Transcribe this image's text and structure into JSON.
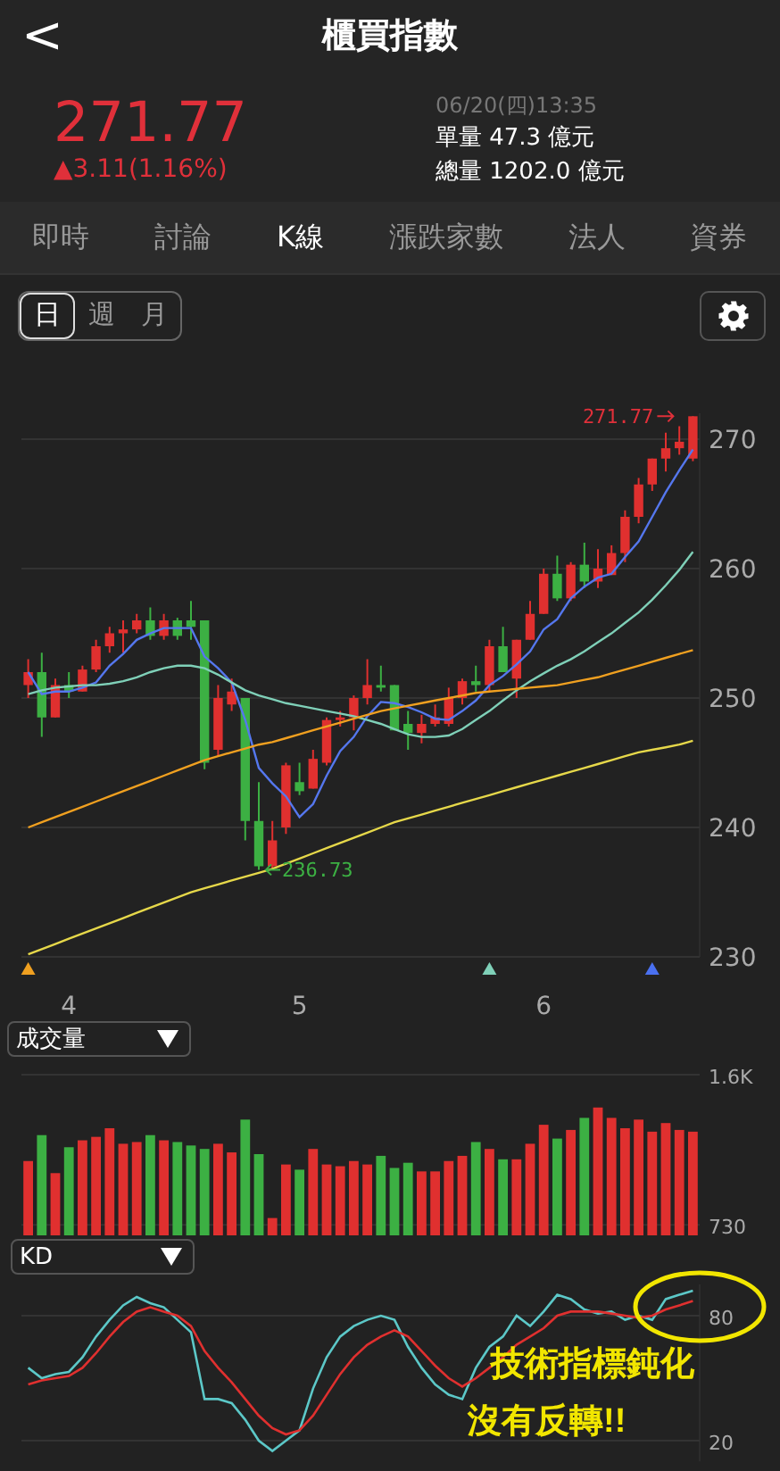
{
  "header": {
    "back_icon": "<",
    "title": "櫃買指數"
  },
  "quote": {
    "price": "271.77",
    "change": "▲3.11(1.16%)",
    "time": "06/20(四)13:35",
    "lines": [
      "單量 47.3 億元",
      "總量 1202.0 億元"
    ]
  },
  "tabs": [
    {
      "label": "即時",
      "selected": false
    },
    {
      "label": "討論",
      "selected": false
    },
    {
      "label": "K線",
      "selected": true
    },
    {
      "label": "漲跌家數",
      "selected": false
    },
    {
      "label": "法人",
      "selected": false
    },
    {
      "label": "資券",
      "selected": false
    }
  ],
  "periods": [
    {
      "label": "日",
      "selected": true
    },
    {
      "label": "週",
      "selected": false
    },
    {
      "label": "月",
      "selected": false
    }
  ],
  "price_chart": {
    "markers": [
      {
        "color": "#f0a020"
      },
      {
        "color": "#7fd0b8"
      },
      {
        "color": "#4a70f0"
      }
    ],
    "chart_data": {
      "type": "candlestick",
      "categories": [
        null,
        null,
        null,
        "4",
        null,
        null,
        null,
        null,
        null,
        null,
        null,
        null,
        null,
        null,
        null,
        null,
        null,
        null,
        null,
        null,
        "5",
        null,
        null,
        null,
        null,
        null,
        null,
        null,
        null,
        null,
        null,
        null,
        null,
        null,
        null,
        null,
        null,
        null,
        "6",
        null,
        null,
        null,
        null,
        null,
        null,
        null,
        null,
        null,
        null,
        null
      ],
      "ylim": [
        230,
        272
      ],
      "yticks": [
        230,
        240,
        250,
        260,
        270
      ],
      "grid": true,
      "series": [
        {
          "type": "candlestick",
          "ohlc": [
            [
              251,
              253,
              250,
              252
            ],
            [
              252,
              253.5,
              247,
              248.5
            ],
            [
              248.5,
              251.5,
              248.5,
              251
            ],
            [
              251,
              252,
              250,
              250.5
            ],
            [
              250.5,
              252.5,
              250.5,
              252.2
            ],
            [
              252.2,
              254.5,
              252,
              254
            ],
            [
              254,
              255.5,
              253.5,
              255
            ],
            [
              255,
              256,
              253.5,
              255.3
            ],
            [
              255.3,
              256.5,
              255,
              256
            ],
            [
              256,
              257,
              254.5,
              254.8
            ],
            [
              254.8,
              256.5,
              254.5,
              256
            ],
            [
              256,
              256.2,
              254.5,
              254.8
            ],
            [
              256,
              257.5,
              254.5,
              255.5
            ],
            [
              256,
              256,
              244.5,
              245
            ],
            [
              246,
              251,
              245.5,
              250
            ],
            [
              249.5,
              251.5,
              249,
              250.5
            ],
            [
              250,
              250,
              239,
              240.5
            ],
            [
              240.5,
              243.5,
              236.73,
              237
            ],
            [
              237,
              240.5,
              236.8,
              239
            ],
            [
              240,
              245,
              239.5,
              244.8
            ],
            [
              243.5,
              245,
              242.5,
              242.8
            ],
            [
              243,
              246,
              243,
              245.3
            ],
            [
              245,
              248.5,
              244.8,
              248.3
            ],
            [
              248.3,
              249,
              247.8,
              248.5
            ],
            [
              248.5,
              250.2,
              247.5,
              250
            ],
            [
              250,
              253,
              249.5,
              251
            ],
            [
              251,
              252.5,
              250.5,
              250.8
            ],
            [
              251,
              251,
              247.5,
              247.5
            ],
            [
              248,
              249,
              246,
              247.3
            ],
            [
              247.3,
              248.7,
              246.5,
              248
            ],
            [
              248,
              249.5,
              247.8,
              248.5
            ],
            [
              248,
              250.8,
              247.8,
              250
            ],
            [
              250,
              251.5,
              249.5,
              251.3
            ],
            [
              251.3,
              252.5,
              250.5,
              251
            ],
            [
              251,
              254.5,
              250.5,
              254
            ],
            [
              254,
              255.5,
              252,
              252
            ],
            [
              251.5,
              254.5,
              250,
              254.5
            ],
            [
              254.5,
              257.5,
              254.5,
              256.5
            ],
            [
              256.5,
              260,
              256.5,
              259.6
            ],
            [
              259.6,
              261,
              257.5,
              257.7
            ],
            [
              257.7,
              260.5,
              257.5,
              260.3
            ],
            [
              260.3,
              262,
              258.5,
              259
            ],
            [
              259,
              261.5,
              258.5,
              260
            ],
            [
              259.5,
              261.8,
              259.5,
              261.2
            ],
            [
              261.2,
              264.5,
              260.5,
              264
            ],
            [
              264,
              267,
              263.5,
              266.5
            ],
            [
              266.5,
              268.5,
              266,
              268.5
            ],
            [
              268.5,
              270.5,
              267.5,
              269.3
            ],
            [
              269.3,
              271,
              268.8,
              269.8
            ],
            [
              268.5,
              271.77,
              268.3,
              271.77
            ]
          ]
        },
        {
          "type": "line",
          "color": "#5577ee",
          "values": [
            252,
            250.3,
            250.5,
            250.5,
            250.8,
            251.2,
            252.5,
            253.4,
            254.5,
            255.0,
            255.4,
            255.4,
            255.4,
            253.2,
            252.3,
            251.2,
            248.3,
            244.6,
            243.4,
            242.4,
            240.8,
            241.8,
            244.0,
            245.9,
            247.0,
            248.6,
            249.7,
            249.6,
            249.3,
            248.9,
            248.4,
            248.3,
            249.0,
            249.8,
            251.0,
            251.7,
            252.6,
            253.6,
            255.3,
            256.1,
            257.7,
            258.6,
            259.3,
            259.6,
            260.9,
            262.1,
            264.0,
            265.9,
            267.6,
            269.2
          ]
        },
        {
          "type": "line",
          "color": "#7fd0b8",
          "values": [
            250.3,
            250.6,
            250.8,
            250.9,
            251.0,
            251.0,
            251.1,
            251.3,
            251.6,
            252.0,
            252.3,
            252.5,
            252.5,
            252.3,
            251.8,
            251.2,
            250.6,
            250.2,
            249.9,
            249.6,
            249.4,
            249.2,
            249.0,
            248.8,
            248.6,
            248.3,
            248.0,
            247.6,
            247.2,
            247.0,
            247.0,
            247.1,
            247.6,
            248.3,
            249.0,
            249.8,
            250.6,
            251.3,
            251.9,
            252.5,
            253.0,
            253.6,
            254.3,
            255.0,
            255.8,
            256.6,
            257.6,
            258.7,
            259.9,
            261.3
          ]
        },
        {
          "type": "line",
          "color": "#f0a020",
          "values": [
            240.0,
            240.4,
            240.8,
            241.2,
            241.6,
            242.0,
            242.4,
            242.8,
            243.2,
            243.6,
            244.0,
            244.4,
            244.8,
            245.2,
            245.5,
            245.8,
            246.1,
            246.4,
            246.6,
            246.9,
            247.2,
            247.5,
            247.8,
            248.1,
            248.4,
            248.7,
            249.0,
            249.2,
            249.4,
            249.6,
            249.8,
            250.0,
            250.2,
            250.4,
            250.5,
            250.6,
            250.7,
            250.8,
            250.9,
            251.0,
            251.2,
            251.4,
            251.6,
            251.9,
            252.2,
            252.5,
            252.8,
            253.1,
            253.4,
            253.7
          ]
        },
        {
          "type": "line",
          "color": "#e6d84a",
          "values": [
            230.2,
            230.6,
            231.0,
            231.4,
            231.8,
            232.2,
            232.6,
            233.0,
            233.4,
            233.8,
            234.2,
            234.6,
            235.0,
            235.3,
            235.6,
            235.9,
            236.2,
            236.5,
            236.8,
            237.2,
            237.6,
            238.0,
            238.4,
            238.8,
            239.2,
            239.6,
            240.0,
            240.4,
            240.7,
            241.0,
            241.3,
            241.6,
            241.9,
            242.2,
            242.5,
            242.8,
            243.1,
            243.4,
            243.7,
            244.0,
            244.3,
            244.6,
            244.9,
            245.2,
            245.5,
            245.8,
            246.0,
            246.2,
            246.4,
            246.7
          ]
        }
      ],
      "annotations": [
        "271.77",
        "236.73"
      ]
    }
  },
  "volume_chart": {
    "selector": "成交量",
    "chart_data": {
      "type": "bar",
      "ylim": [
        680,
        1600
      ],
      "yticks": [
        {
          "value": 1600,
          "label": "1.6K"
        },
        {
          "value": 730,
          "label": "730"
        }
      ],
      "series": [
        {
          "color": "#e0302f",
          "values": [
            1100,
            null,
            1030,
            null,
            1220,
            1240,
            1290,
            1200,
            1210,
            null,
            1220,
            null,
            null,
            null,
            1200,
            1150,
            null,
            null,
            770,
            1080,
            null,
            1170,
            1080,
            1070,
            1100,
            1080,
            null,
            null,
            null,
            1040,
            1040,
            1100,
            1130,
            null,
            1170,
            null,
            1110,
            1200,
            1310,
            null,
            1280,
            null,
            1410,
            1350,
            1290,
            1340,
            1270,
            1320,
            1280,
            1270
          ]
        },
        {
          "color": "#3cb043",
          "values": [
            null,
            1250,
            null,
            1180,
            null,
            null,
            null,
            null,
            null,
            1250,
            null,
            1210,
            1190,
            1170,
            null,
            null,
            1340,
            1140,
            null,
            null,
            1050,
            null,
            null,
            null,
            null,
            null,
            1130,
            1060,
            1090,
            null,
            null,
            null,
            null,
            1210,
            null,
            1110,
            null,
            null,
            null,
            1230,
            null,
            1350,
            null,
            null,
            null,
            null,
            null,
            null,
            null,
            null
          ]
        }
      ]
    }
  },
  "kd_chart": {
    "selector": "KD",
    "chart_data": {
      "type": "line",
      "ylim": [
        10,
        95
      ],
      "yticks": [
        20,
        80
      ],
      "series": [
        {
          "color": "#5cc8c8",
          "values": [
            55,
            50,
            52,
            53,
            60,
            70,
            78,
            85,
            89,
            86,
            84,
            78,
            72,
            40,
            40,
            38,
            30,
            20,
            15,
            20,
            25,
            45,
            60,
            70,
            75,
            78,
            80,
            78,
            65,
            55,
            47,
            42,
            40,
            55,
            65,
            70,
            80,
            75,
            82,
            90,
            88,
            83,
            81,
            82,
            78,
            80,
            78,
            88,
            90,
            92
          ]
        },
        {
          "color": "#e0302f",
          "values": [
            47,
            49,
            50,
            51,
            55,
            62,
            70,
            77,
            82,
            84,
            82,
            80,
            75,
            63,
            55,
            48,
            40,
            32,
            26,
            23,
            25,
            32,
            42,
            52,
            60,
            66,
            70,
            73,
            70,
            63,
            56,
            50,
            46,
            50,
            55,
            60,
            66,
            70,
            74,
            80,
            82,
            82,
            82,
            81,
            80,
            79,
            80,
            83,
            85,
            87
          ]
        }
      ],
      "annotations": [
        "技術指標鈍化",
        "沒有反轉!!"
      ]
    }
  }
}
